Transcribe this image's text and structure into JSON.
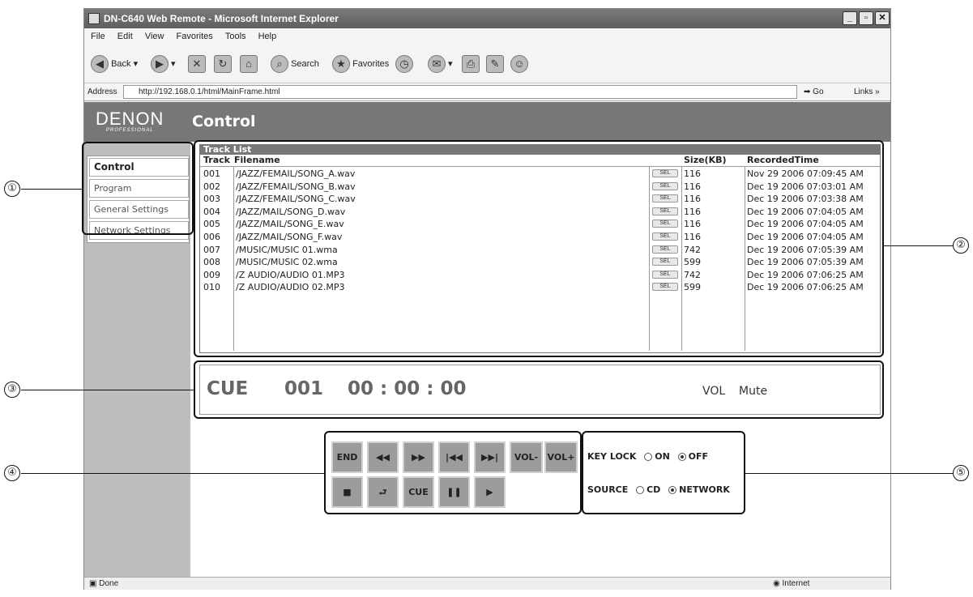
{
  "window": {
    "title": "DN-C640 Web Remote - Microsoft Internet Explorer"
  },
  "menubar": {
    "items": [
      "File",
      "Edit",
      "View",
      "Favorites",
      "Tools",
      "Help"
    ]
  },
  "toolbar": {
    "back": "Back",
    "search": "Search",
    "favorites": "Favorites"
  },
  "address": {
    "label": "Address",
    "url": "http://192.168.0.1/html/MainFrame.html",
    "go": "Go",
    "links": "Links"
  },
  "header": {
    "logo": "DENON",
    "logo_sub": "PROFESSIONAL",
    "title": "Control"
  },
  "sidebar": {
    "items": [
      {
        "label": "Control"
      },
      {
        "label": "Program"
      },
      {
        "label": "General Settings"
      },
      {
        "label": "Network Settings"
      }
    ]
  },
  "tracklist": {
    "title": "Track List",
    "columns": [
      "Track",
      "Filename",
      "Size(KB)",
      "RecordedTime"
    ],
    "sel_label": "SEL",
    "rows": [
      {
        "track": "001",
        "file": "/JAZZ/FEMAIL/SONG_A.wav",
        "size": "116",
        "time": "Nov 29 2006 07:09:45 AM"
      },
      {
        "track": "002",
        "file": "/JAZZ/FEMAIL/SONG_B.wav",
        "size": "116",
        "time": "Dec 19 2006 07:03:01 AM"
      },
      {
        "track": "003",
        "file": "/JAZZ/FEMAIL/SONG_C.wav",
        "size": "116",
        "time": "Dec 19 2006 07:03:38 AM"
      },
      {
        "track": "004",
        "file": "/JAZZ/MAIL/SONG_D.wav",
        "size": "116",
        "time": "Dec 19 2006 07:04:05 AM"
      },
      {
        "track": "005",
        "file": "/JAZZ/MAIL/SONG_E.wav",
        "size": "116",
        "time": "Dec 19 2006 07:04:05 AM"
      },
      {
        "track": "006",
        "file": "/JAZZ/MAIL/SONG_F.wav",
        "size": "116",
        "time": "Dec 19 2006 07:04:05 AM"
      },
      {
        "track": "007",
        "file": "/MUSIC/MUSIC 01.wma",
        "size": "742",
        "time": "Dec 19 2006 07:05:39 AM"
      },
      {
        "track": "008",
        "file": "/MUSIC/MUSIC 02.wma",
        "size": "599",
        "time": "Dec 19 2006 07:05:39 AM"
      },
      {
        "track": "009",
        "file": "/Z AUDIO/AUDIO 01.MP3",
        "size": "742",
        "time": "Dec 19 2006 07:06:25 AM"
      },
      {
        "track": "010",
        "file": "/Z AUDIO/AUDIO 02.MP3",
        "size": "599",
        "time": "Dec 19 2006 07:06:25 AM"
      }
    ]
  },
  "display": {
    "mode": "CUE",
    "track": "001",
    "time": "00 : 00 : 00",
    "vol_label": "VOL",
    "vol_value": "Mute"
  },
  "controls": {
    "end": "END",
    "vol_minus": "VOL-",
    "vol_plus": "VOL+",
    "cue": "CUE",
    "icons": {
      "rew": "◀◀",
      "ff": "▶▶",
      "prev": "|◀◀",
      "next": "▶▶|",
      "stop": "■",
      "repeat": "⮐",
      "pause": "❚❚",
      "play": "▶"
    }
  },
  "options": {
    "keylock_label": "KEY LOCK",
    "on": "ON",
    "off": "OFF",
    "source_label": "SOURCE",
    "cd": "CD",
    "network": "NETWORK"
  },
  "statusbar": {
    "status": "Done",
    "zone": "Internet"
  },
  "callouts": [
    "①",
    "②",
    "③",
    "④",
    "⑤"
  ]
}
